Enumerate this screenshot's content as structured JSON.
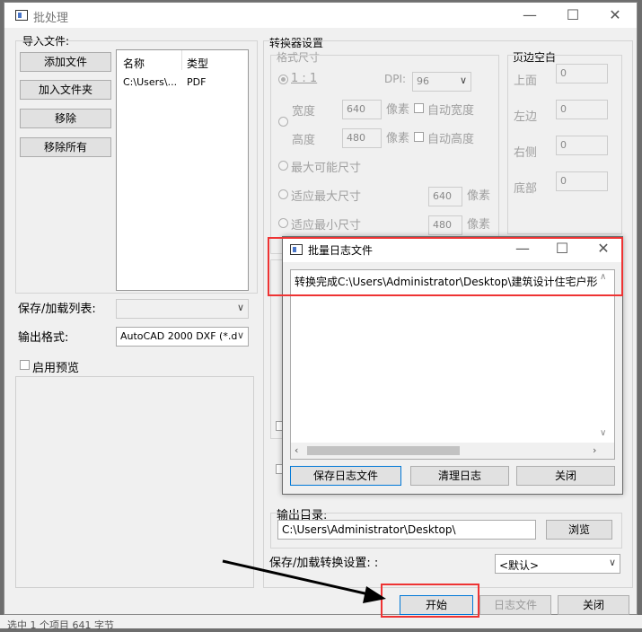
{
  "window": {
    "title": "批处理"
  },
  "import": {
    "section_label": "导入文件:",
    "add_file": "添加文件",
    "add_folder": "加入文件夹",
    "remove": "移除",
    "remove_all": "移除所有",
    "columns": [
      "名称",
      "类型"
    ],
    "rows": [
      {
        "name": "C:\\Users\\...",
        "type": "PDF"
      }
    ]
  },
  "left_lower": {
    "save_load_list_label": "保存/加载列表:",
    "output_format_label": "输出格式:",
    "output_format_value": "AutoCAD 2000 DXF (*.d:",
    "enable_preview_label": "启用预览"
  },
  "converter": {
    "section_label": "转换器设置",
    "format_size_label": "格式尺寸",
    "ratio_label": "1 : 1",
    "dpi_label": "DPI:",
    "dpi_value": "96",
    "width_label": "宽度",
    "width_value": "640",
    "height_label": "高度",
    "height_value": "480",
    "pixel_label": "像素",
    "auto_width_label": "自动宽度",
    "auto_height_label": "自动高度",
    "max_possible_label": "最大可能尺寸",
    "fit_max_label": "适应最大尺寸",
    "fit_max_value": "640",
    "fit_min_label": "适应最小尺寸",
    "fit_min_value": "480"
  },
  "margins": {
    "section_label": "页边空白",
    "top_label": "上面",
    "top_value": "0",
    "left_label": "左边",
    "left_value": "0",
    "right_label": "右侧",
    "right_value": "0",
    "bottom_label": "底部",
    "bottom_value": "0"
  },
  "output": {
    "dir_label": "输出目录:",
    "dir_value": "C:\\Users\\Administrator\\Desktop\\",
    "browse": "浏览",
    "save_load_settings_label": "保存/加载转换设置: :",
    "settings_value": "<默认>"
  },
  "footer": {
    "start": "开始",
    "log_file": "日志文件",
    "close": "关闭"
  },
  "log_dialog": {
    "title": "批量日志文件",
    "log_line": "转换完成C:\\Users\\Administrator\\Desktop\\建筑设计住宅户形",
    "save_log": "保存日志文件",
    "clear_log": "清理日志",
    "close": "关闭"
  },
  "status_bar": {
    "text": "选中 1 个项目 641 字节"
  },
  "colors": {
    "highlight_red": "#e33333",
    "accent_blue": "#0078d7"
  }
}
